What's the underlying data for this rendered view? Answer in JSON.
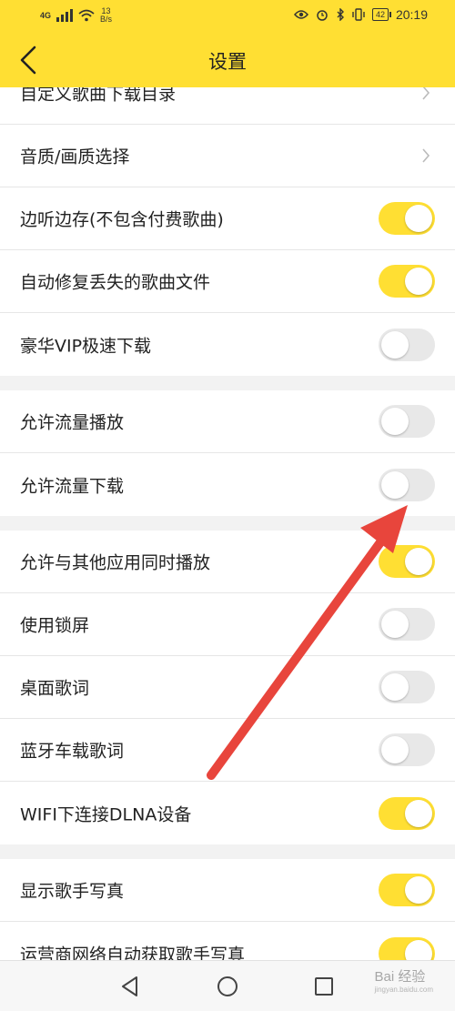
{
  "status_bar": {
    "network": "4G",
    "speed_value": "13",
    "speed_unit": "B/s",
    "battery": "42",
    "time": "20:19"
  },
  "header": {
    "title": "设置"
  },
  "groups": [
    [
      {
        "label": "自定义歌曲下载目录",
        "control": "chevron"
      },
      {
        "label": "音质/画质选择",
        "control": "chevron"
      },
      {
        "label": "边听边存(不包含付费歌曲)",
        "control": "toggle",
        "on": true
      },
      {
        "label": "自动修复丢失的歌曲文件",
        "control": "toggle",
        "on": true
      },
      {
        "label": "豪华VIP极速下载",
        "control": "toggle",
        "on": false
      }
    ],
    [
      {
        "label": "允许流量播放",
        "control": "toggle",
        "on": false
      },
      {
        "label": "允许流量下载",
        "control": "toggle",
        "on": false
      }
    ],
    [
      {
        "label": "允许与其他应用同时播放",
        "control": "toggle",
        "on": true
      },
      {
        "label": "使用锁屏",
        "control": "toggle",
        "on": false
      },
      {
        "label": "桌面歌词",
        "control": "toggle",
        "on": false
      },
      {
        "label": "蓝牙车载歌词",
        "control": "toggle",
        "on": false
      },
      {
        "label": "WIFI下连接DLNA设备",
        "control": "toggle",
        "on": true
      }
    ],
    [
      {
        "label": "显示歌手写真",
        "control": "toggle",
        "on": true
      },
      {
        "label": "运营商网络自动获取歌手写真",
        "control": "toggle",
        "on": true
      }
    ]
  ],
  "watermark": {
    "text": "Bai 经验",
    "sub": "jingyan.baidu.com"
  },
  "colors": {
    "accent": "#ffdf33",
    "arrow": "#e8453c"
  },
  "icons": {
    "back": "chevron-left-icon",
    "row_chevron": "chevron-right-icon",
    "nav_back": "triangle-back-icon",
    "nav_home": "circle-home-icon",
    "nav_recents": "square-recents-icon"
  }
}
